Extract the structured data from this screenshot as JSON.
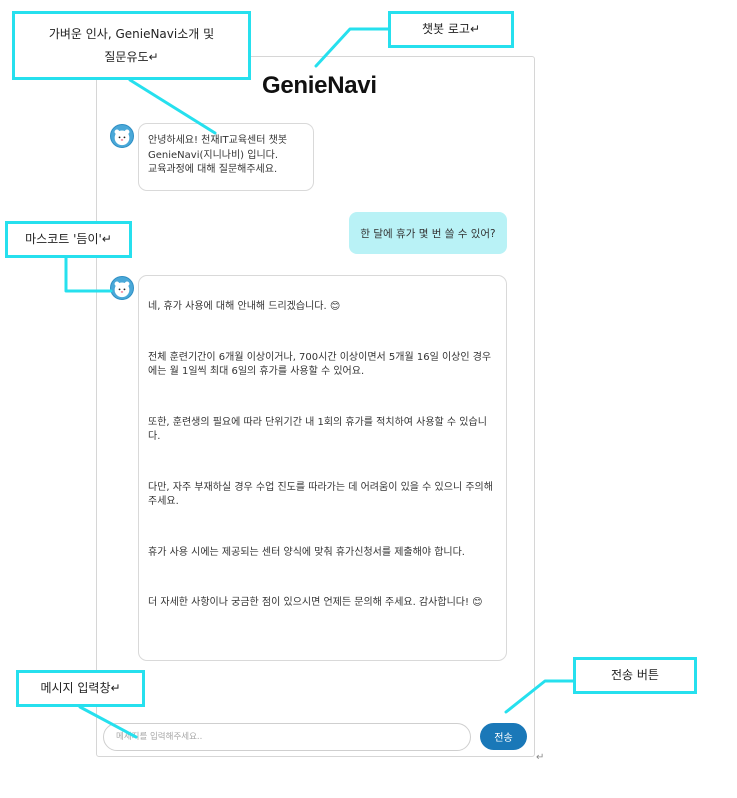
{
  "chat": {
    "logo": "GenieNavi",
    "greeting_lines": [
      "안녕하세요! 천재IT교육센터 챗봇",
      "GenieNavi(지니나비) 입니다.",
      "교육과정에 대해 질문해주세요."
    ],
    "user_message": "한 달에 휴가 몇 번 쓸 수 있어?",
    "bot_reply_paragraphs": [
      "네, 휴가 사용에 대해 안내해 드리겠습니다. 😊",
      "전체 훈련기간이 6개월 이상이거나, 700시간 이상이면서 5개월 16일 이상인 경우에는 월 1일씩 최대 6일의 휴가를 사용할 수 있어요.",
      "또한, 훈련생의 필요에 따라 단위기간 내 1회의 휴가를 적치하여 사용할 수 있습니다.",
      "다만, 자주 부재하실 경우 수업 진도를 따라가는 데 어려움이 있을 수 있으니 주의해 주세요.",
      "휴가 사용 시에는 제공되는 센터 양식에 맞춰 휴가신청서를 제출해야 합니다.",
      "더 자세한 사항이나 궁금한 점이 있으시면 언제든 문의해 주세요. 감사합니다! 😊"
    ],
    "input_placeholder": "메세지를 입력해주세요..",
    "input_value": "",
    "send_label": "전송"
  },
  "annotations": {
    "greeting": [
      "가벼운 인사, GenieNavi소개 및",
      "질문유도↵"
    ],
    "logo": "챗봇 로고↵",
    "mascot": "마스코트 '듬이'↵",
    "input": "메시지 입력창↵",
    "send": "전송 버튼"
  },
  "return_marks": [
    "↵",
    "↵"
  ],
  "colors": {
    "annotation_border": "#26e0ee",
    "user_bubble": "#b9f2f6",
    "send_button": "#1a78b8",
    "mascot": "#4aa8d8"
  },
  "icons": {
    "mascot": "mascot-avatar-icon"
  }
}
